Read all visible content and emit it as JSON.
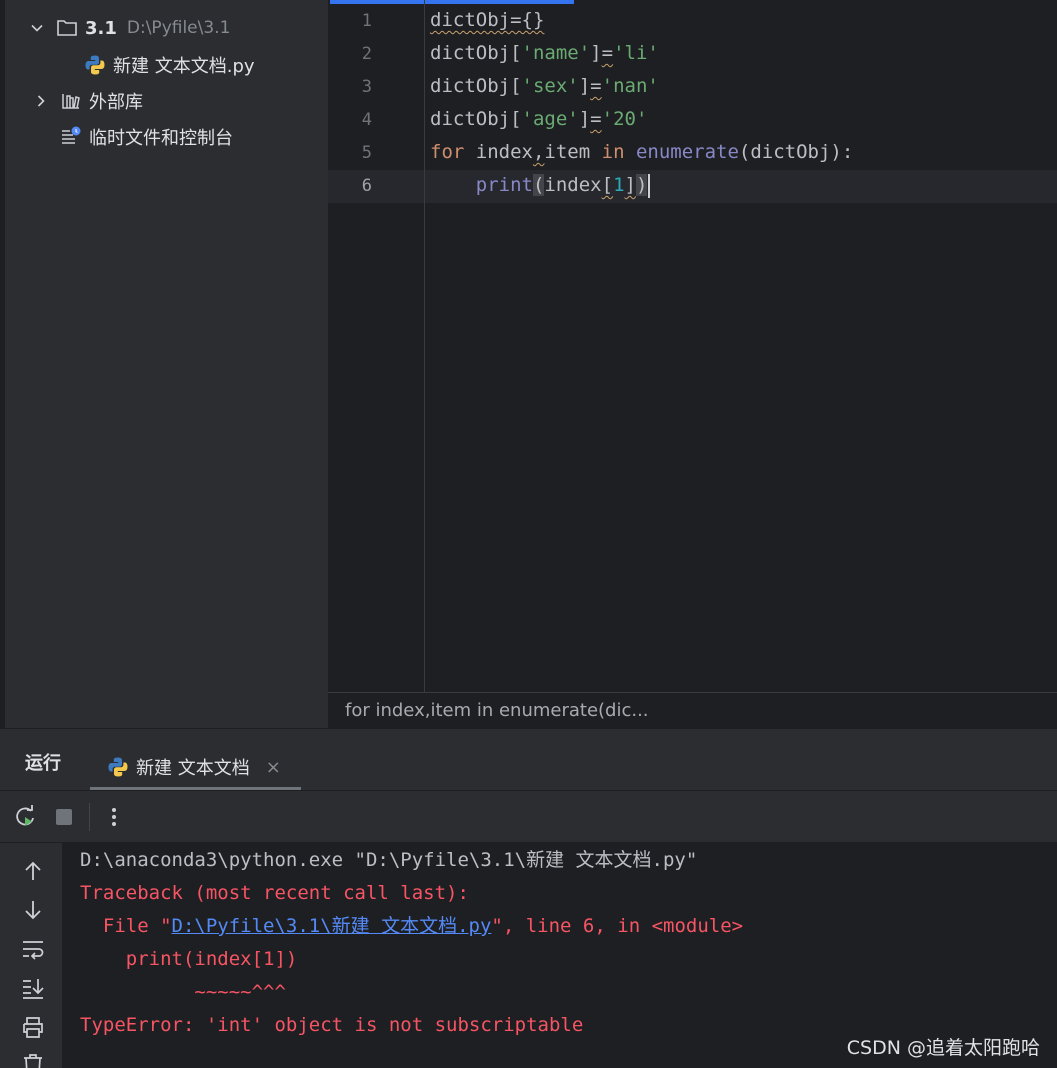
{
  "project": {
    "folder_name": "3.1",
    "folder_path": "D:\\Pyfile\\3.1",
    "file_name": "新建 文本文档.py",
    "external_libs": "外部库",
    "scratches": "临时文件和控制台"
  },
  "editor": {
    "line_numbers": [
      "1",
      "2",
      "3",
      "4",
      "5",
      "6"
    ],
    "breadcrumb": "for index,item in enumerate(dic..."
  },
  "run": {
    "title": "运行",
    "tab_label": "新建 文本文档",
    "tab_close": "×",
    "console": {
      "command": "D:\\anaconda3\\python.exe \"D:\\Pyfile\\3.1\\新建 文本文档.py\"",
      "traceback": "Traceback (most recent call last):",
      "file_prefix": "  File \"",
      "file_link": "D:\\Pyfile\\3.1\\新建 文本文档.py",
      "file_suffix": "\", line 6, in <module>",
      "code_line": "    print(index[1])",
      "marker": "          ~~~~~^^^",
      "error": "TypeError: 'int' object is not subscriptable"
    }
  },
  "watermark": "CSDN @追着太阳跑哈",
  "icons": {
    "folder": "folder-icon",
    "python_file": "python-file-icon",
    "library": "library-icon",
    "scratches": "scratches-icon",
    "rerun": "rerun-icon",
    "stop": "stop-icon",
    "more": "more-icon",
    "up": "arrow-up-icon",
    "down": "arrow-down-icon",
    "soft_wrap": "soft-wrap-icon",
    "scroll_end": "scroll-to-end-icon",
    "print": "print-icon",
    "trash": "trash-icon"
  },
  "colors": {
    "accent": "#3574f0",
    "error": "#f75464",
    "link": "#548af7",
    "string": "#6aab73",
    "keyword": "#cf8e6d",
    "builtin": "#8888c6"
  }
}
